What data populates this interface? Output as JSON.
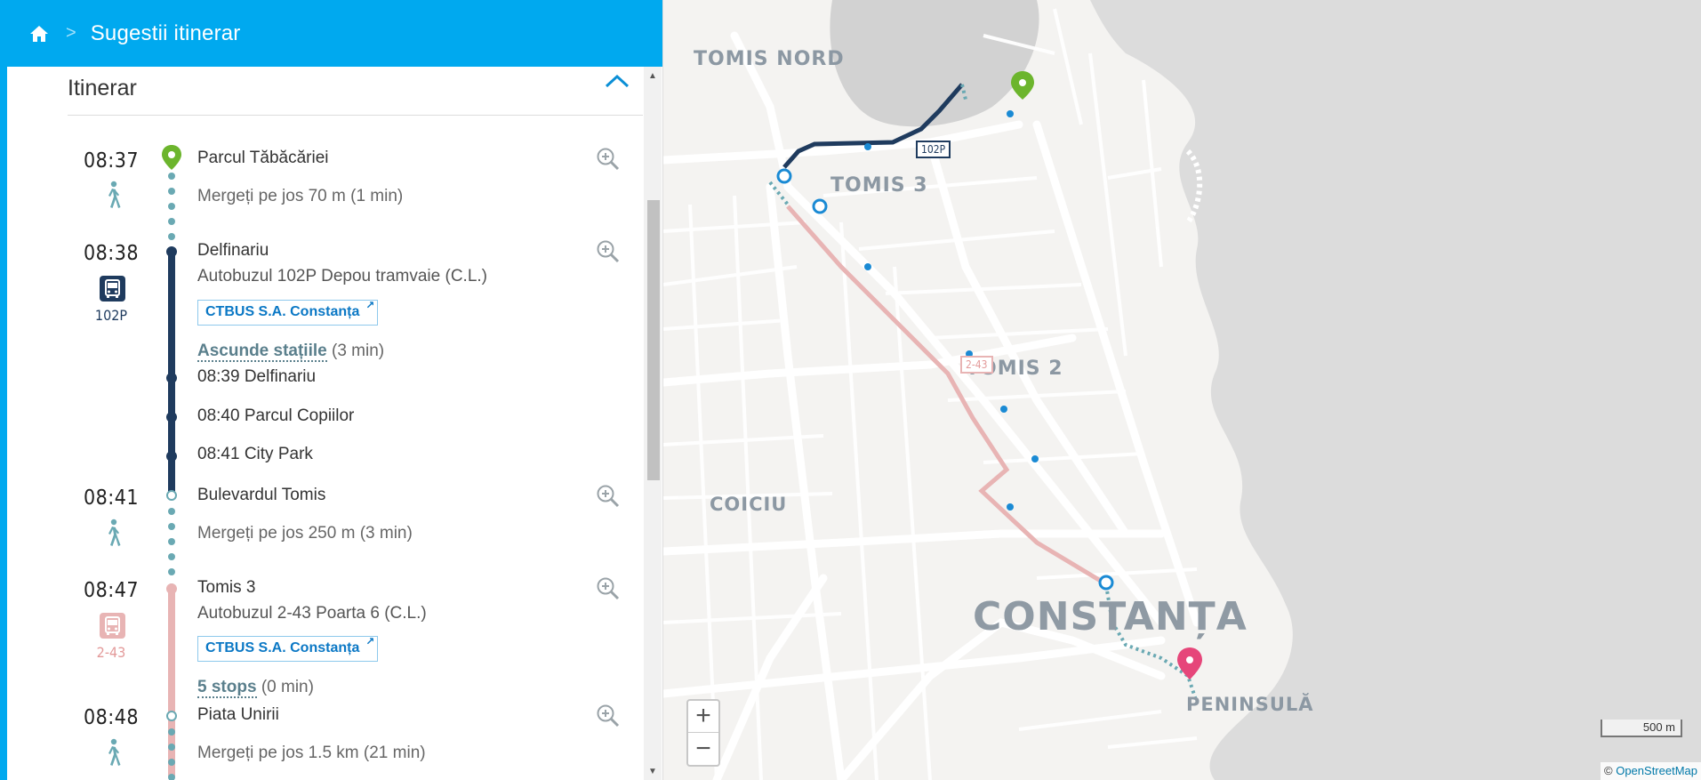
{
  "header": {
    "home_icon": "home-icon",
    "separator": ">",
    "title": "Sugestii itinerar"
  },
  "itinerary": {
    "title": "Itinerar",
    "collapse_icon": "chevron-up-icon",
    "steps": [
      {
        "time": "08:37",
        "mode": "walk",
        "stop": "Parcul Tăbăcăriei",
        "detail": "Mergeți pe jos 70 m (1 min)"
      },
      {
        "time": "08:38",
        "mode": "bus",
        "line": "102P",
        "stop": "Delfinariu",
        "route": "Autobuzul 102P Depou tramvaie (C.L.)",
        "operator": "CTBUS S.A. Constanța",
        "toggle_label": "Ascunde stațiile",
        "toggle_duration": "(3 min)",
        "intermediate_stops": [
          "08:39 Delfinariu",
          "08:40 Parcul Copiilor",
          "08:41 City Park"
        ]
      },
      {
        "time": "08:41",
        "mode": "walk",
        "stop": "Bulevardul Tomis",
        "detail": "Mergeți pe jos 250 m (3 min)"
      },
      {
        "time": "08:47",
        "mode": "bus",
        "line": "2-43",
        "stop": "Tomis 3",
        "route": "Autobuzul 2-43 Poarta 6 (C.L.)",
        "operator": "CTBUS S.A. Constanța",
        "toggle_label": "5 stops",
        "toggle_duration": "(0 min)"
      },
      {
        "time": "08:48",
        "mode": "walk",
        "stop": "Piata Unirii",
        "detail": "Mergeți pe jos 1.5 km (21 min)"
      }
    ]
  },
  "colors": {
    "header_bg": "#00a9ef",
    "line_102P": "#1f3b5e",
    "line_2_43": "#e8b4b4",
    "walk": "#6aa9b3",
    "origin_pin": "#6cb52d",
    "destination_pin": "#e6467a",
    "operator_link": "#0b78c5"
  },
  "map": {
    "labels": {
      "tomis_nord": "TOMIS NORD",
      "tomis_3": "TOMIS 3",
      "tomis_2": "TOMIS 2",
      "coiciu": "COICIU",
      "constanta": "CONSTANȚA",
      "peninsula": "PENINSULĂ"
    },
    "route_badges": {
      "first": "102P",
      "second": "2-43"
    },
    "zoom_in": "+",
    "zoom_out": "−",
    "scale": "500 m",
    "attribution_prefix": "©",
    "attribution_link": "OpenStreetMap"
  }
}
